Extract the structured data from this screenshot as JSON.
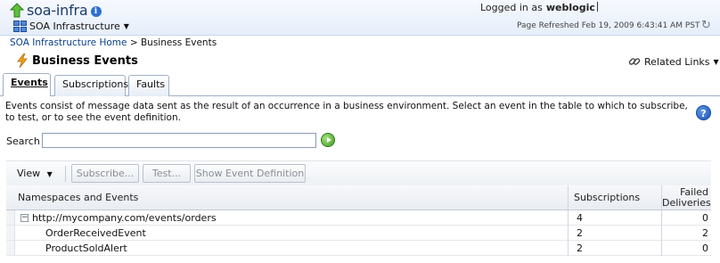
{
  "header": {
    "app_title": "soa-infra",
    "info_icon": "info-icon",
    "target_menu": "SOA Infrastructure",
    "logged_in_prefix": "Logged in as",
    "username": "weblogic",
    "page_refreshed": "Page Refreshed Feb 19, 2009 6:43:41 AM PST"
  },
  "breadcrumb": {
    "home": "SOA Infrastructure Home",
    "separator": ">",
    "current": "Business Events"
  },
  "page": {
    "title": "Business Events",
    "related_links": "Related Links"
  },
  "tabs": [
    {
      "label": "Events",
      "active": true
    },
    {
      "label": "Subscriptions",
      "active": false
    },
    {
      "label": "Faults",
      "active": false
    }
  ],
  "description": "Events consist of message data sent as the result of an occurrence in a business environment. Select an event in the table to which to subscribe, to test, or to see the event definition.",
  "search": {
    "label": "Search",
    "value": ""
  },
  "toolbar": {
    "view": "View",
    "subscribe": "Subscribe...",
    "test": "Test...",
    "show_definition": "Show Event Definition"
  },
  "table": {
    "columns": {
      "name": "Namespaces and Events",
      "subscriptions": "Subscriptions",
      "failed_line1": "Failed",
      "failed_line2": "Deliveries"
    },
    "rows": [
      {
        "name": "http://mycompany.com/events/orders",
        "subscriptions": "4",
        "failed": "0",
        "expanded": true
      },
      {
        "name": "OrderReceivedEvent",
        "subscriptions": "2",
        "failed": "2"
      },
      {
        "name": "ProductSoldAlert",
        "subscriptions": "2",
        "failed": "0"
      }
    ]
  },
  "colors": {
    "header_bg": "#e6eefa",
    "link": "#0b3f8f",
    "go_green": "#3e9a22",
    "help_blue": "#1d56b8"
  }
}
